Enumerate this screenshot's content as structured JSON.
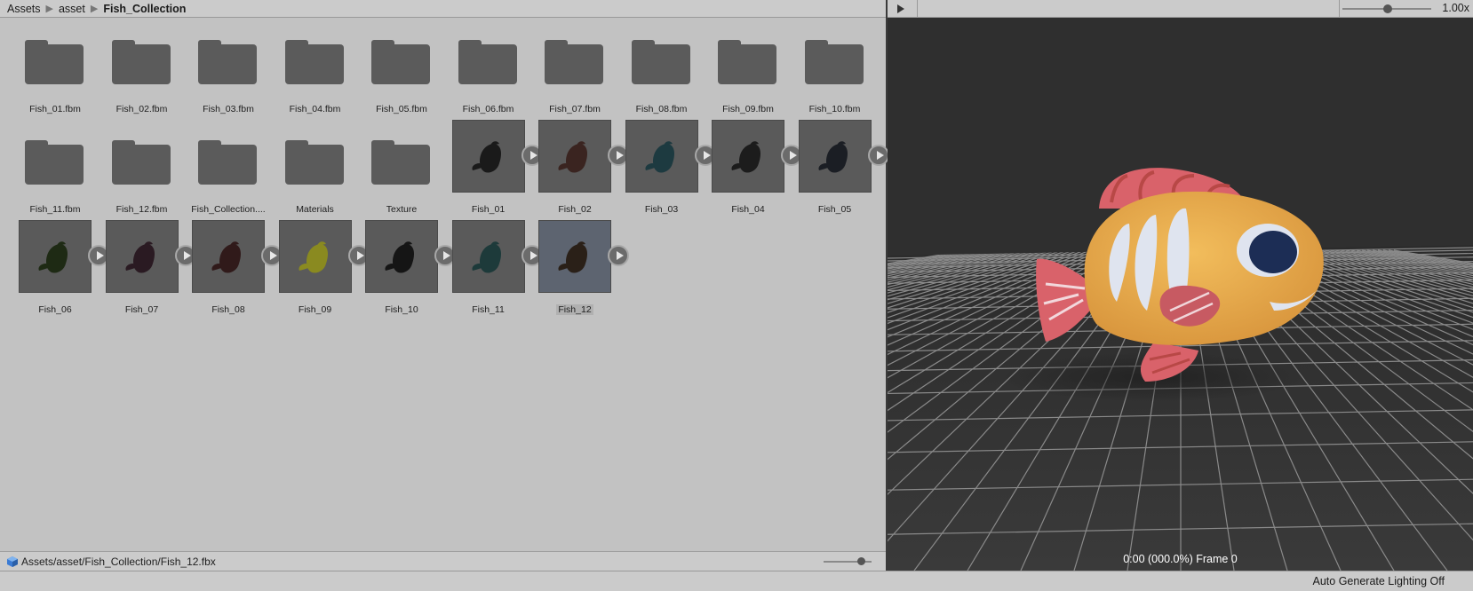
{
  "breadcrumb": {
    "items": [
      "Assets",
      "asset",
      "Fish_Collection"
    ]
  },
  "assets": {
    "folders_row1": [
      "Fish_01.fbm",
      "Fish_02.fbm",
      "Fish_03.fbm",
      "Fish_04.fbm",
      "Fish_05.fbm",
      "Fish_06.fbm",
      "Fish_07.fbm",
      "Fish_08.fbm",
      "Fish_09.fbm",
      "Fish_10.fbm"
    ],
    "folders_row2": [
      "Fish_11.fbm",
      "Fish_12.fbm",
      "Fish_Collection....",
      "Materials",
      "Texture"
    ],
    "models_row2": [
      "Fish_01",
      "Fish_02",
      "Fish_03",
      "Fish_04",
      "Fish_05"
    ],
    "models_row3": [
      "Fish_06",
      "Fish_07",
      "Fish_08",
      "Fish_09",
      "Fish_10",
      "Fish_11",
      "Fish_12"
    ],
    "selected": "Fish_12"
  },
  "status": {
    "path": "Assets/asset/Fish_Collection/Fish_12.fbx"
  },
  "preview": {
    "speed": "1.00x",
    "frame": "0:00 (000.0%) Frame 0"
  },
  "footer": {
    "lighting": "Auto Generate Lighting Off"
  },
  "colors": {
    "fish_body": "#e9a94a",
    "fish_fin": "#d9626a",
    "fish_eye": "#1c2d55",
    "stripe": "#dfe4ef"
  }
}
